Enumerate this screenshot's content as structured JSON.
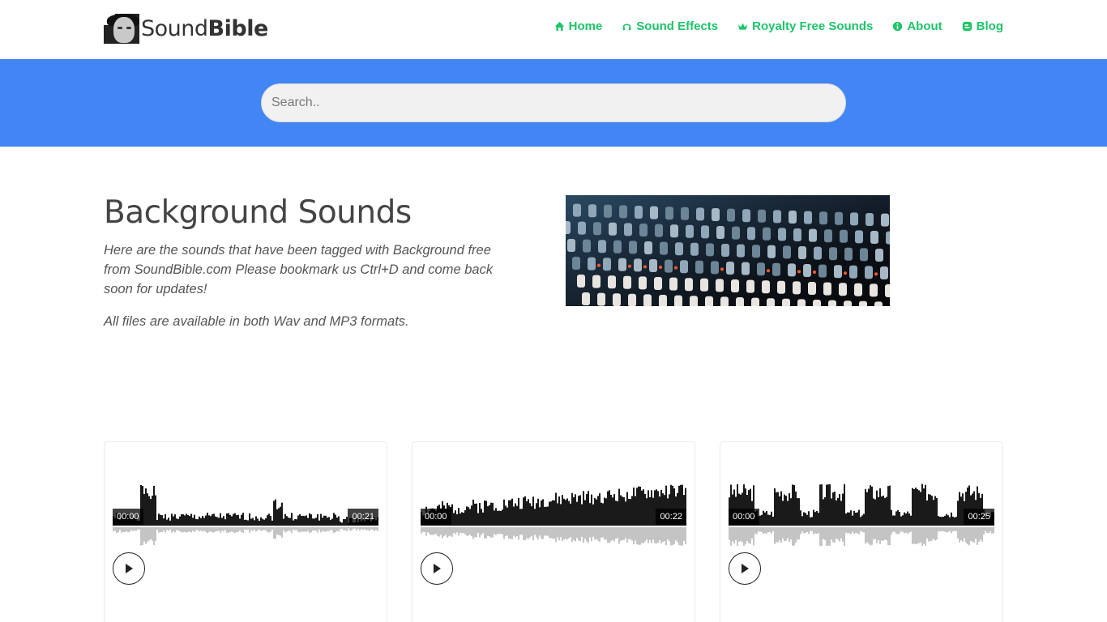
{
  "header": {
    "logo": {
      "text_regular": "Sound",
      "text_bold": "Bible"
    },
    "nav": [
      {
        "label": "Home",
        "icon": "home-icon"
      },
      {
        "label": "Sound Effects",
        "icon": "headphones-icon"
      },
      {
        "label": "Royalty Free Sounds",
        "icon": "crown-icon"
      },
      {
        "label": "About",
        "icon": "info-icon"
      },
      {
        "label": "Blog",
        "icon": "blog-icon"
      }
    ]
  },
  "search": {
    "placeholder": "Search.."
  },
  "intro": {
    "title": "Background Sounds",
    "description": "Here are the sounds that have been tagged with Background free from SoundBible.com Please bookmark us Ctrl+D and come back soon for updates!",
    "formats_note": "All files are available in both Wav and MP3 formats."
  },
  "colors": {
    "accent": "#1fc46a",
    "band": "#4285f4"
  },
  "cards": [
    {
      "start_time": "00:00",
      "end_time": "00:21"
    },
    {
      "start_time": "00:00",
      "end_time": "00:22"
    },
    {
      "start_time": "00:00",
      "end_time": "00:25"
    }
  ]
}
